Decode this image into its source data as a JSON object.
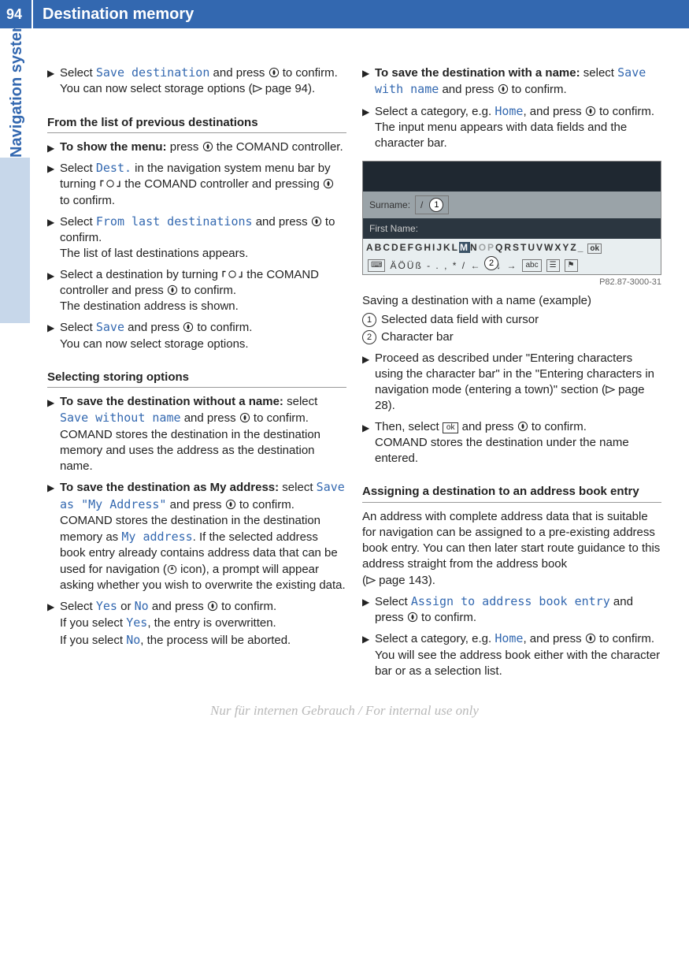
{
  "header": {
    "page_number": "94",
    "title": "Destination memory"
  },
  "side_tab": "Navigation system",
  "left": {
    "step1": {
      "pre": "Select ",
      "term": "Save destination",
      "post": " and press ",
      "tail": " to confirm.",
      "note": "You can now select storage options (",
      "ref": " page 94)."
    },
    "heading1": "From the list of previous destinations",
    "step2": {
      "bold": "To show the menu:",
      "post": " press ",
      "tail": " the COMAND controller."
    },
    "step3": {
      "pre": "Select ",
      "term": "Dest.",
      "mid": " in the navigation system menu bar by turning ",
      "mid2": " the COMAND controller and pressing ",
      "tail": " to confirm."
    },
    "step4": {
      "pre": "Select ",
      "term": "From last destinations",
      "mid": " and press ",
      "tail": " to confirm.",
      "note": "The list of last destinations appears."
    },
    "step5": {
      "pre": "Select a destination by turning ",
      "mid": " the COMAND controller and press ",
      "tail": " to con­firm.",
      "note": "The destination address is shown."
    },
    "step6": {
      "pre": "Select ",
      "term": "Save",
      "mid": " and press ",
      "tail": " to confirm.",
      "note": "You can now select storage options."
    },
    "heading2": "Selecting storing options",
    "step7": {
      "bold": "To save the destination without a name:",
      "mid": " select ",
      "term": "Save without name",
      "mid2": " and press ",
      "tail": " to confirm.",
      "note": "COMAND stores the destination in the des­tination memory and uses the address as the destination name."
    },
    "step8": {
      "bold": "To save the destination as My address:",
      "mid": " select ",
      "term": "Save as \"My Address\"",
      "mid2": " and press ",
      "tail": " to confirm.",
      "note_a": "COMAND stores the destination in the des­tination memory as ",
      "note_term": "My address",
      "note_b": ". If the selected address book entry already con­tains address data that can be used for navigation (",
      "note_c": " icon), a prompt will appear asking whether you wish to overwrite the existing data."
    },
    "step9": {
      "pre": "Select ",
      "yes": "Yes",
      "or": " or ",
      "no": "No",
      "mid": " and press ",
      "tail": " to confirm.",
      "line2a": "If you select ",
      "line2b": ", the entry is overwritten.",
      "line3a": "If you select ",
      "line3b": ", the process will be aborted."
    }
  },
  "right": {
    "step1": {
      "bold": "To save the destination with a name:",
      "mid": " select ",
      "term": "Save with name",
      "mid2": " and press ",
      "tail": " to confirm."
    },
    "step2": {
      "pre": "Select a category, e.g. ",
      "term": "Home",
      "mid": ", and press ",
      "tail": " to confirm.",
      "note": "The input menu appears with data fields and the character bar."
    },
    "screenshot": {
      "row1_label": "Surname:",
      "row1_cursor": "/",
      "row2_label": "First Name:",
      "charbar_left": "ABCDEFGHIJKL",
      "charbar_hi": "M",
      "charbar_mid": "N",
      "charbar_right": "QRSTUVWXYZ_",
      "ok": "ok",
      "symrow": "ÄÖÜß - . , *  / ← ↑ ↓ →",
      "abc_chip": "abc",
      "code": "P82.87-3000-31"
    },
    "caption": "Saving a destination with a name (example)",
    "legend1": "Selected data field with cursor",
    "legend2": "Character bar",
    "step3": {
      "pre": "Proceed as described under \"Entering char­acters using the character bar\" in the \"Entering characters in navigation mode (entering a town)\" section (",
      "ref": " page 28)."
    },
    "step4": {
      "pre": "Then, select  ",
      "ok": "ok",
      "mid": "  and press ",
      "tail": " to confirm.",
      "note": "COMAND stores the destination under the name entered."
    },
    "heading1": "Assigning a destination to an address book entry",
    "para1": "An address with complete address data that is suitable for navigation can be assigned to a pre-existing address book entry. You can then later start route guidance to this address straight from the address book",
    "para1_ref": " page 143).",
    "step5": {
      "pre": "Select ",
      "term": "Assign to address book entry",
      "mid": " and press ",
      "tail": " to confirm."
    },
    "step6": {
      "pre": "Select a category, e.g. ",
      "term": "Home",
      "mid": ", and press ",
      "tail": " to confirm.",
      "note": "You will see the address book either with the character bar or as a selection list."
    }
  },
  "footer": "Nur für internen Gebrauch / For internal use only"
}
